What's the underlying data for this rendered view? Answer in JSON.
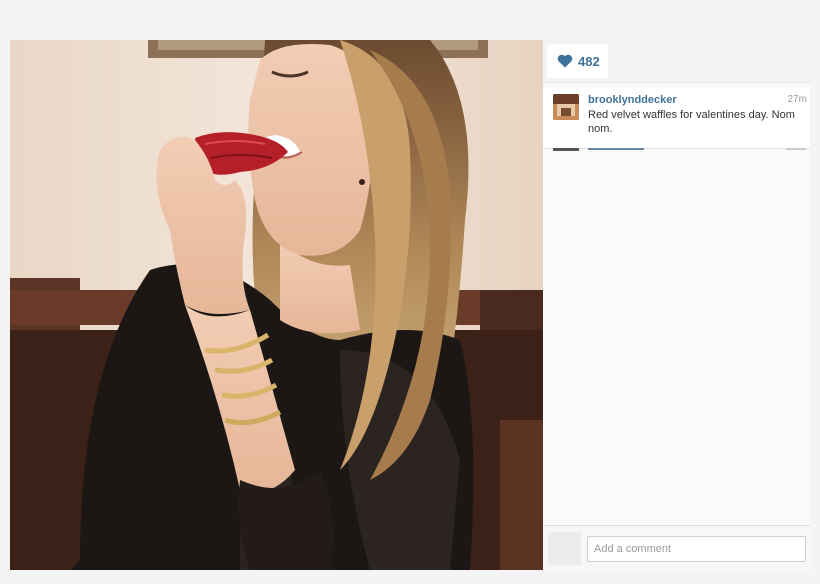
{
  "post": {
    "likes": "482",
    "username": "brooklynddecker",
    "timestamp": "27m",
    "caption": "Red velvet waffles for valentines day. Nom nom."
  },
  "comment": {
    "placeholder": "Add a comment"
  },
  "colors": {
    "link": "#3f729b",
    "heart": "#3f729b"
  },
  "icons": {
    "like": "heart-icon"
  }
}
